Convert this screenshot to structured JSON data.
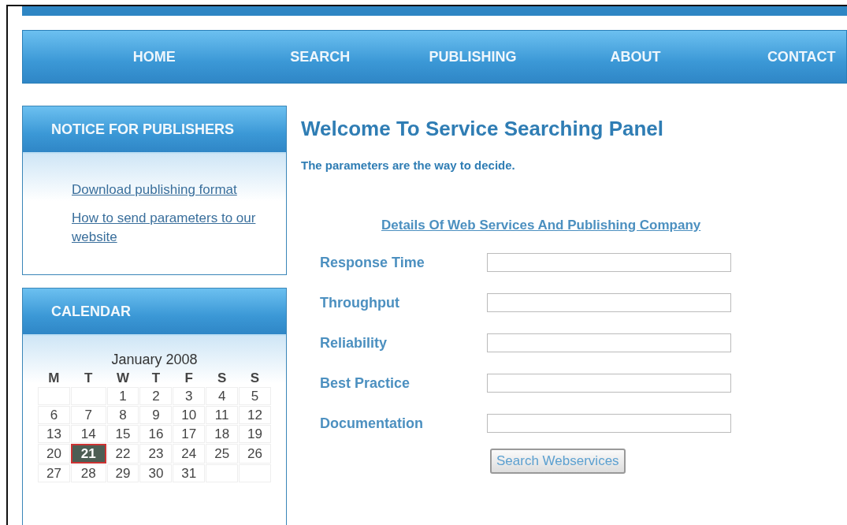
{
  "nav": [
    {
      "label": "HOME"
    },
    {
      "label": "SEARCH"
    },
    {
      "label": "PUBLISHING"
    },
    {
      "label": "ABOUT"
    },
    {
      "label": "CONTACT"
    }
  ],
  "notice": {
    "title": "NOTICE FOR PUBLISHERS",
    "links": [
      "Download publishing format",
      "How to send parameters to our website"
    ]
  },
  "calendar": {
    "title": "CALENDAR",
    "month": "January 2008",
    "weekdays": [
      "M",
      "T",
      "W",
      "T",
      "F",
      "S",
      "S"
    ],
    "weeks": [
      [
        {
          "day": "1",
          "selected": false
        },
        {
          "day": "2",
          "selected": false
        },
        {
          "day": "3",
          "selected": false
        },
        {
          "day": "4",
          "selected": false
        },
        {
          "day": "5",
          "selected": false
        }
      ],
      [
        {
          "day": "6",
          "selected": false
        },
        {
          "day": "7",
          "selected": false
        },
        {
          "day": "8",
          "selected": false
        },
        {
          "day": "9",
          "selected": false
        },
        {
          "day": "10",
          "selected": false
        },
        {
          "day": "11",
          "selected": false
        },
        {
          "day": "12",
          "selected": false
        }
      ],
      [
        {
          "day": "13",
          "selected": false
        },
        {
          "day": "14",
          "selected": false
        },
        {
          "day": "15",
          "selected": false
        },
        {
          "day": "16",
          "selected": false
        },
        {
          "day": "17",
          "selected": false
        },
        {
          "day": "18",
          "selected": false
        },
        {
          "day": "19",
          "selected": false
        }
      ],
      [
        {
          "day": "20",
          "selected": false
        },
        {
          "day": "21",
          "selected": true
        },
        {
          "day": "22",
          "selected": false
        },
        {
          "day": "23",
          "selected": false
        },
        {
          "day": "24",
          "selected": false
        },
        {
          "day": "25",
          "selected": false
        },
        {
          "day": "26",
          "selected": false
        }
      ],
      [
        {
          "day": "27",
          "selected": false
        },
        {
          "day": "28",
          "selected": false
        },
        {
          "day": "29",
          "selected": false
        },
        {
          "day": "30",
          "selected": false
        },
        {
          "day": "31",
          "selected": false
        }
      ]
    ]
  },
  "main": {
    "heading": "Welcome To Service Searching Panel",
    "intro": "The parameters are the way to decide.",
    "form_title": "Details Of Web Services And Publishing Company",
    "fields": [
      {
        "label": "Response Time"
      },
      {
        "label": "Throughput"
      },
      {
        "label": "Reliability"
      },
      {
        "label": "Best Practice"
      },
      {
        "label": "Documentation"
      }
    ],
    "button": "Search Webservices"
  }
}
